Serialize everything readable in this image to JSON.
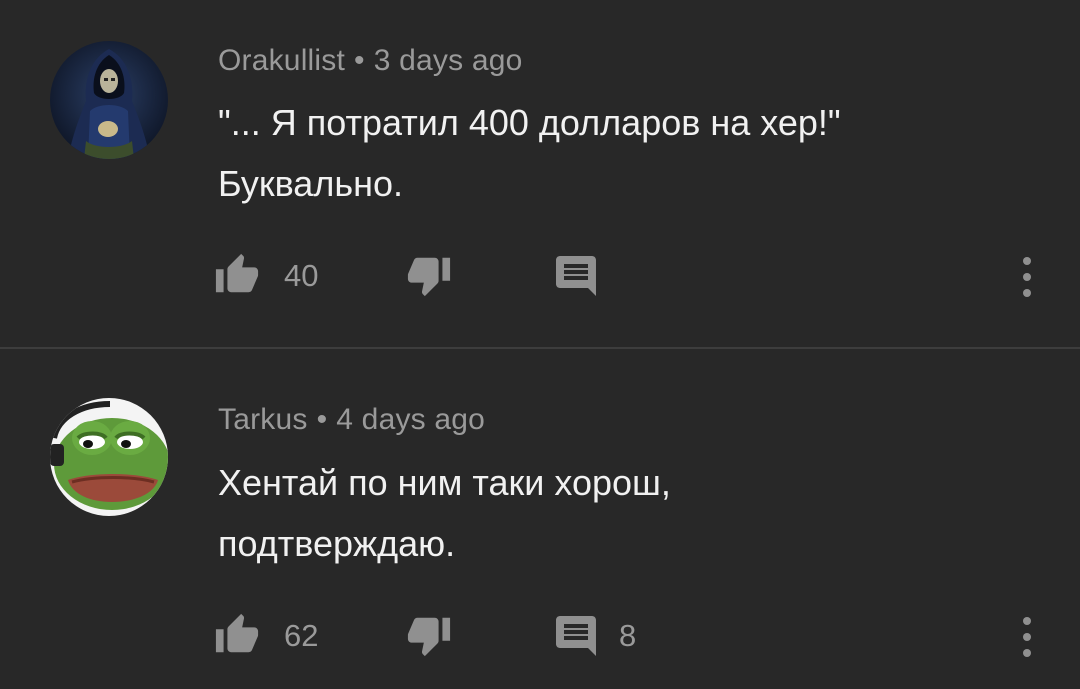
{
  "comments": [
    {
      "author": "Orakullist",
      "separator": "•",
      "time": "3 days ago",
      "text_lines": [
        "\"... Я потратил 400 долларов на хер!\"",
        "Буквально."
      ],
      "likes": "40",
      "replies": "",
      "avatar": "hooded-figure-avatar"
    },
    {
      "author": "Tarkus",
      "separator": "•",
      "time": "4 days ago",
      "text_lines": [
        "Хентай по ним таки хорош,",
        "подтверждаю."
      ],
      "likes": "62",
      "replies": "8",
      "avatar": "frog-avatar"
    }
  ],
  "icons": {
    "like": "thumbs-up-icon",
    "dislike": "thumbs-down-icon",
    "reply": "comment-icon",
    "more": "more-vertical-icon"
  },
  "colors": {
    "background": "#282828",
    "text": "#f1f1f1",
    "meta": "#9a9a9a",
    "icon": "#909090",
    "divider": "#3d3d3d"
  }
}
